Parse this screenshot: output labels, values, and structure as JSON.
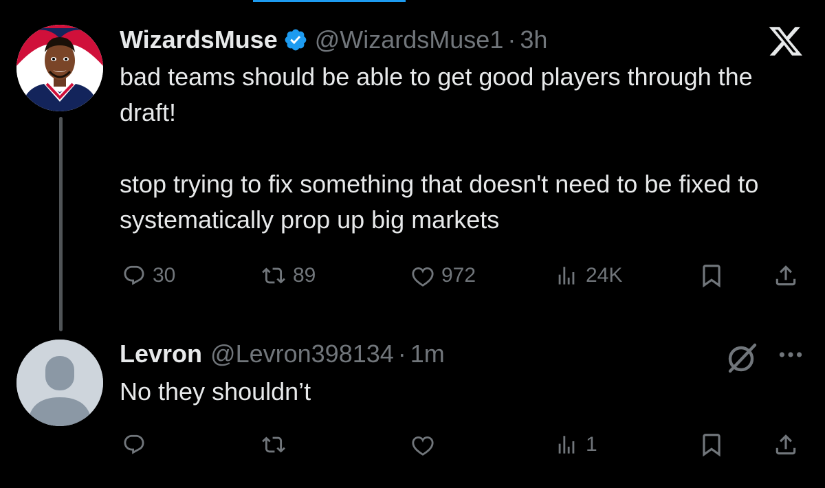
{
  "tweet": {
    "name": "WizardsMuse",
    "handle": "@WizardsMuse1",
    "sep": "·",
    "time": "3h",
    "text": "bad teams should be able to get good players through the draft!\n\nstop trying to fix something that doesn't need to be fixed to systematically prop up big markets",
    "actions": {
      "replies": "30",
      "reposts": "89",
      "likes": "972",
      "views": "24K"
    }
  },
  "reply": {
    "name": "Levron",
    "handle": "@Levron398134",
    "sep": "·",
    "time": "1m",
    "text": "No they shouldn’t",
    "actions": {
      "replies": "",
      "reposts": "",
      "likes": "",
      "views": "1"
    }
  },
  "colors": {
    "background": "#000000",
    "text": "#e7e9ea",
    "muted": "#71767b",
    "accent": "#1d9bf0"
  },
  "icons": [
    "verified-badge-icon",
    "x-logo-icon",
    "reply-icon",
    "repost-icon",
    "like-icon",
    "views-icon",
    "bookmark-icon",
    "share-icon",
    "grok-icon",
    "more-icon"
  ]
}
